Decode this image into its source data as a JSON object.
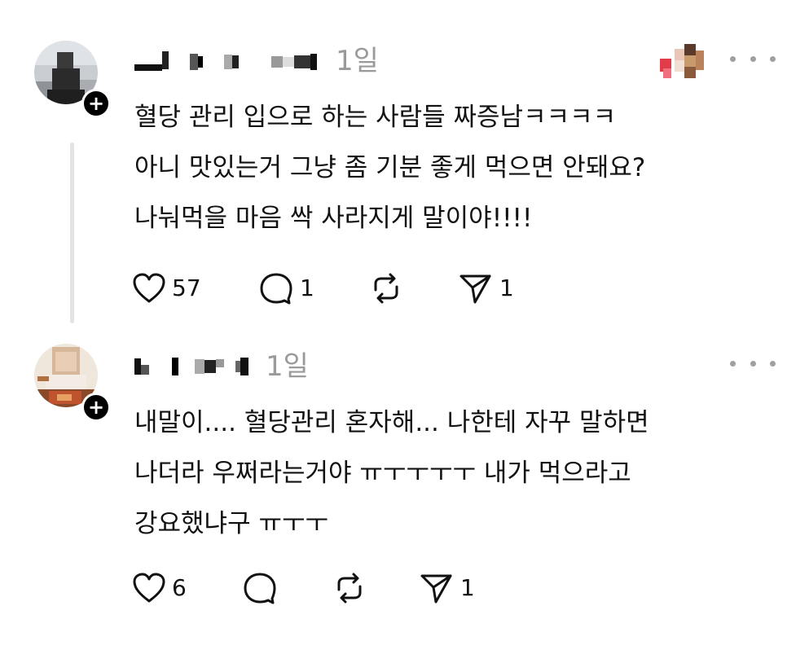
{
  "posts": [
    {
      "timestamp": "1일",
      "body_lines": [
        "혈당 관리 입으로 하는 사람들 짜증남ㅋㅋㅋㅋ",
        "아니 맛있는거 그냥 좀 기분 좋게 먹으면 안돼요?",
        "나눠먹을 마음 싹 사라지게 말이야!!!!"
      ],
      "likes": "57",
      "replies": "1",
      "reposts": "",
      "shares": "1",
      "follow_symbol": "+"
    },
    {
      "timestamp": "1일",
      "body_lines": [
        "내말이.... 혈당관리 혼자해... 나한테 자꾸 말하면",
        "나더라 우쩌라는거야 ㅠㅜㅜㅜㅜ 내가 먹으라고",
        "강요했냐구 ㅠㅜㅜ"
      ],
      "likes": "6",
      "replies": "",
      "reposts": "",
      "shares": "1",
      "follow_symbol": "+"
    }
  ],
  "icons": {
    "like": "heart-icon",
    "reply": "comment-icon",
    "repost": "repost-icon",
    "share": "send-icon",
    "more": "more-options-icon",
    "follow": "plus-icon"
  }
}
